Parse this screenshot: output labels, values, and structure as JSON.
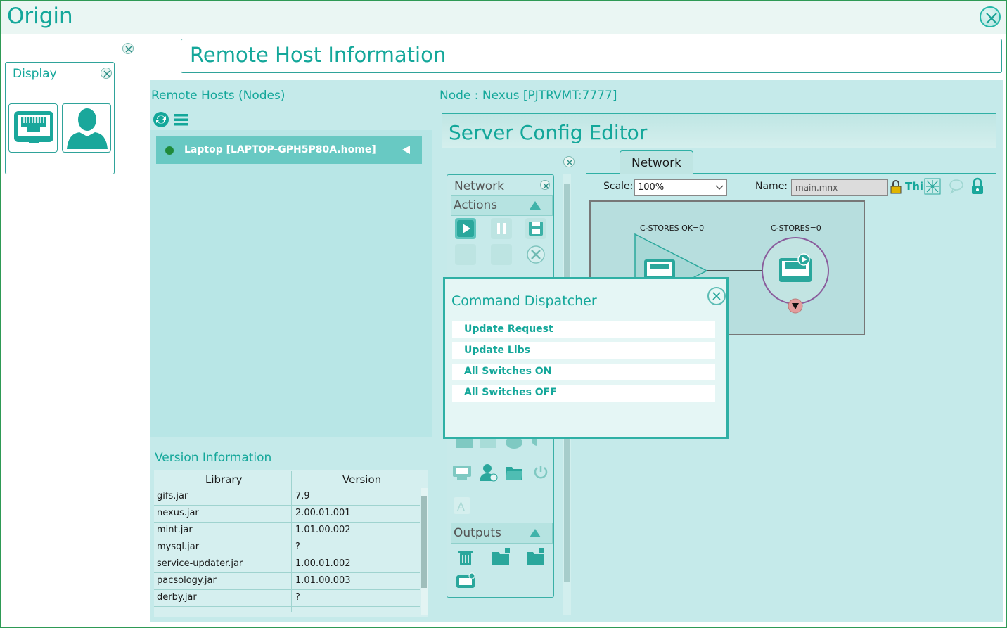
{
  "window": {
    "title": "Origin"
  },
  "left_panel": {
    "display_label": "Display"
  },
  "header": {
    "title": "Remote Host Information"
  },
  "hosts": {
    "title": "Remote Hosts (Nodes)",
    "items": [
      {
        "label": "Laptop [LAPTOP-GPH5P80A.home]",
        "status_color": "#1f8a3a"
      }
    ]
  },
  "node_label": "Node : Nexus [PJTRVMT:7777]",
  "version_info": {
    "title": "Version Information",
    "columns": [
      "Library",
      "Version"
    ],
    "rows": [
      [
        "gifs.jar",
        "7.9"
      ],
      [
        "nexus.jar",
        "2.00.01.001"
      ],
      [
        "mint.jar",
        "1.01.00.002"
      ],
      [
        "mysql.jar",
        "?"
      ],
      [
        "service-updater.jar",
        "1.00.01.002"
      ],
      [
        "pacsology.jar",
        "1.01.00.003"
      ],
      [
        "derby.jar",
        "?"
      ]
    ]
  },
  "editor": {
    "title": "Server Config Editor",
    "tab": "Network",
    "scale_label": "Scale:",
    "scale_value": "100%",
    "name_label": "Name:",
    "name_value": "main.mnx",
    "thi_label": "Thi",
    "canvas": {
      "node1_label": "C-STORES OK=0",
      "node2_label": "C-STORES=0"
    }
  },
  "toolbox": {
    "title": "Network",
    "actions": "Actions",
    "outputs": "Outputs"
  },
  "dispatcher": {
    "title": "Command Dispatcher",
    "items": [
      "Update Request",
      "Update Libs",
      "All Switches ON",
      "All Switches OFF"
    ]
  },
  "colors": {
    "accent": "#14a79a",
    "frame": "#2e9a55",
    "panel": "#c5eaea"
  }
}
